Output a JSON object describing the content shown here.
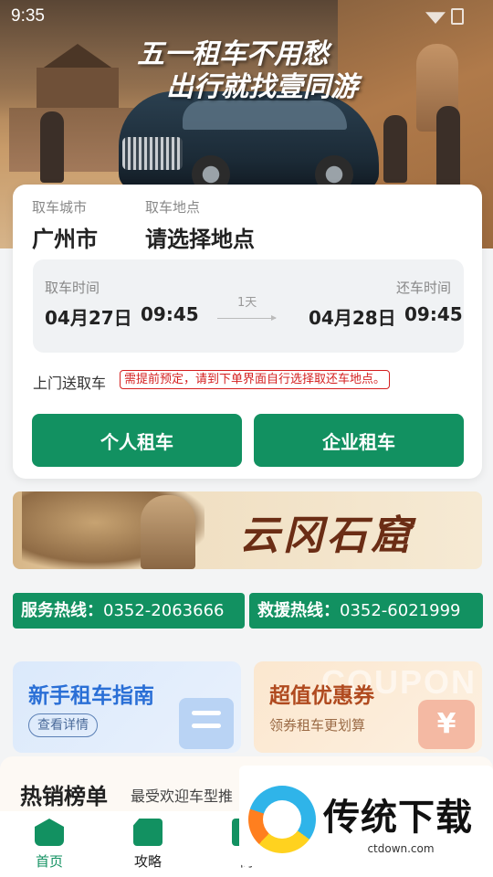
{
  "status_bar": {
    "time": "9:35"
  },
  "hero": {
    "slogan_line1": "五一租车不用愁",
    "slogan_line2": "出行就找壹同游"
  },
  "booking": {
    "city_label": "取车城市",
    "city_value": "广州市",
    "location_label": "取车地点",
    "location_value": "请选择地点",
    "pickup_time_label": "取车时间",
    "pickup_date": "04月27日",
    "pickup_time": "09:45",
    "duration": "1天",
    "return_time_label": "还车时间",
    "return_date": "04月28日",
    "return_time": "09:45",
    "delivery_label": "上门送取车",
    "delivery_tip": "需提前预定，请到下单界面自行选择取还车地点。",
    "personal_button": "个人租车",
    "enterprise_button": "企业租车"
  },
  "banner": {
    "title": "云冈石窟"
  },
  "hotlines": {
    "service_label": "服务热线：",
    "service_number": "0352-2063666",
    "rescue_label": "救援热线：",
    "rescue_number": "0352-6021999"
  },
  "promos": {
    "guide_title": "新手租车指南",
    "guide_button": "查看详情",
    "coupon_title": "超值优惠券",
    "coupon_subtitle": "领券租车更划算",
    "coupon_watermark": "COUPON",
    "coupon_symbol": "¥"
  },
  "ranking": {
    "title": "热销榜单",
    "subtitle": "最受欢迎车型推"
  },
  "tabbar": {
    "items": [
      {
        "label": "首页"
      },
      {
        "label": "攻略"
      },
      {
        "label": "商"
      }
    ]
  },
  "watermark": {
    "brand": "传统下载",
    "url": "ctdown.com"
  },
  "colors": {
    "primary": "#129161",
    "tip": "#d41f1f"
  }
}
